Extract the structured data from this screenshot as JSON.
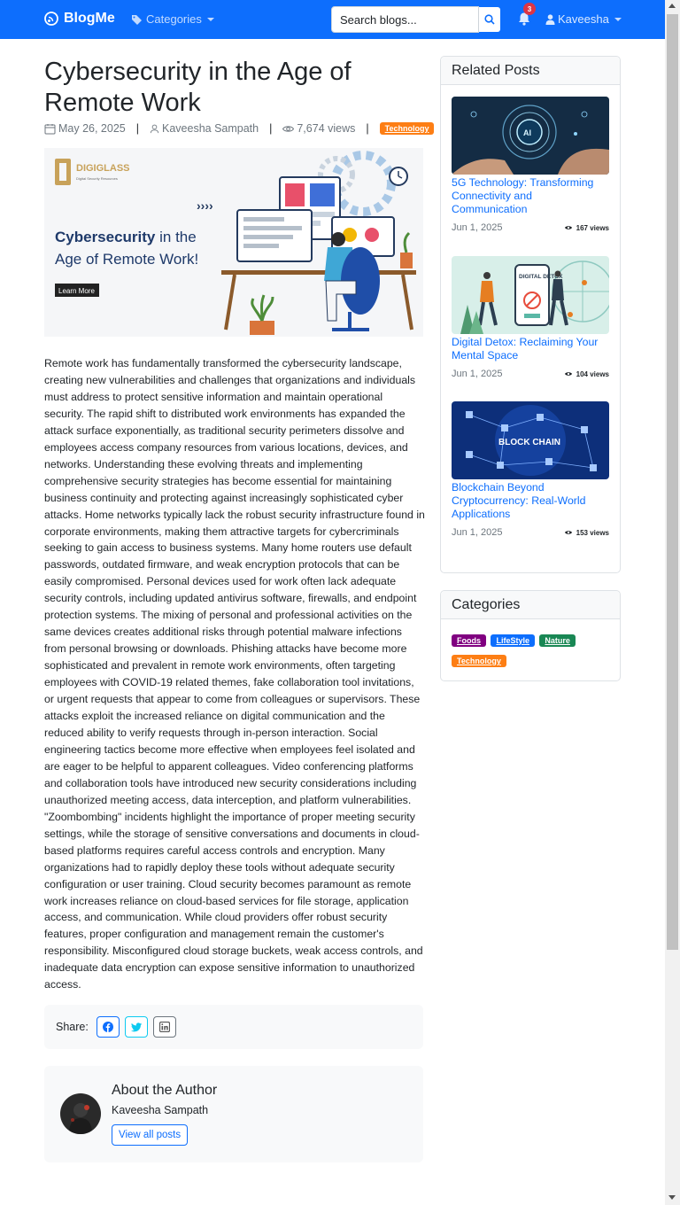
{
  "navbar": {
    "brand": "BlogMe",
    "categories_label": "Categories",
    "search_placeholder": "Search blogs...",
    "notification_count": "3",
    "username": "Kaveesha"
  },
  "post": {
    "title": "Cybersecurity in the Age of Remote Work",
    "date": "May 26, 2025",
    "author": "Kaveesha Sampath",
    "views": "7,674 views",
    "category": "Technology",
    "hero": {
      "logo": "DIGIGLASS",
      "logo_sub": "Digital Security Resources",
      "heading_bold": "Cybersecurity",
      "heading_rest": " in the",
      "heading_line2": "Age of Remote Work!",
      "button": "Learn More"
    },
    "body": "Remote work has fundamentally transformed the cybersecurity landscape, creating new vulnerabilities and challenges that organizations and individuals must address to protect sensitive information and maintain operational security. The rapid shift to distributed work environments has expanded the attack surface exponentially, as traditional security perimeters dissolve and employees access company resources from various locations, devices, and networks. Understanding these evolving threats and implementing comprehensive security strategies has become essential for maintaining business continuity and protecting against increasingly sophisticated cyber attacks. Home networks typically lack the robust security infrastructure found in corporate environments, making them attractive targets for cybercriminals seeking to gain access to business systems. Many home routers use default passwords, outdated firmware, and weak encryption protocols that can be easily compromised. Personal devices used for work often lack adequate security controls, including updated antivirus software, firewalls, and endpoint protection systems. The mixing of personal and professional activities on the same devices creates additional risks through potential malware infections from personal browsing or downloads. Phishing attacks have become more sophisticated and prevalent in remote work environments, often targeting employees with COVID-19 related themes, fake collaboration tool invitations, or urgent requests that appear to come from colleagues or supervisors. These attacks exploit the increased reliance on digital communication and the reduced ability to verify requests through in-person interaction. Social engineering tactics become more effective when employees feel isolated and are eager to be helpful to apparent colleagues. Video conferencing platforms and collaboration tools have introduced new security considerations including unauthorized meeting access, data interception, and platform vulnerabilities. \"Zoombombing\" incidents highlight the importance of proper meeting security settings, while the storage of sensitive conversations and documents in cloud-based platforms requires careful access controls and encryption. Many organizations had to rapidly deploy these tools without adequate security configuration or user training. Cloud security becomes paramount as remote work increases reliance on cloud-based services for file storage, application access, and communication. While cloud providers offer robust security features, proper configuration and management remain the customer's responsibility. Misconfigured cloud storage buckets, weak access controls, and inadequate data encryption can expose sensitive information to unauthorized access."
  },
  "share": {
    "label": "Share:",
    "buttons": [
      {
        "icon": "facebook-icon",
        "color": "#0d6efd"
      },
      {
        "icon": "twitter-icon",
        "color": "#0dcaf0"
      },
      {
        "icon": "linkedin-icon",
        "color": "#6c757d"
      }
    ]
  },
  "author_box": {
    "heading": "About the Author",
    "name": "Kaveesha Sampath",
    "button": "View all posts"
  },
  "sidebar": {
    "related_heading": "Related Posts",
    "related": [
      {
        "title": "5G Technology: Transforming Connectivity and Communication",
        "date": "Jun 1, 2025",
        "views": "167 views",
        "image_text": "AI"
      },
      {
        "title": "Digital Detox: Reclaiming Your Mental Space",
        "date": "Jun 1, 2025",
        "views": "104 views",
        "image_text": "DIGITAL DETOX"
      },
      {
        "title": "Blockchain Beyond Cryptocurrency: Real-World Applications",
        "date": "Jun 1, 2025",
        "views": "153 views",
        "image_text": "BLOCK CHAIN"
      }
    ],
    "categories_heading": "Categories",
    "categories": [
      {
        "label": "Foods",
        "color": "#800080"
      },
      {
        "label": "LifeStyle",
        "color": "#0d6efd"
      },
      {
        "label": "Nature",
        "color": "#198754"
      },
      {
        "label": "Technology",
        "color": "#fd7e14"
      }
    ]
  },
  "colors": {
    "primary": "#0d6efd",
    "danger": "#dc3545",
    "muted": "#6c757d"
  }
}
